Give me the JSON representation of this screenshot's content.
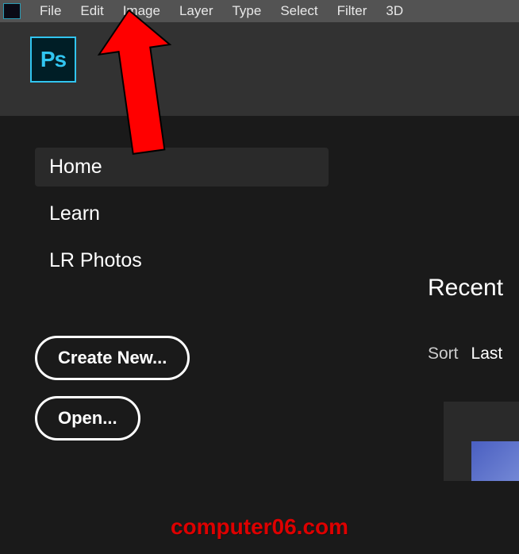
{
  "menubar": {
    "items": [
      "File",
      "Edit",
      "Image",
      "Layer",
      "Type",
      "Select",
      "Filter",
      "3D"
    ]
  },
  "logo": {
    "text": "Ps"
  },
  "sidebar": {
    "items": [
      {
        "label": "Home",
        "active": true
      },
      {
        "label": "Learn",
        "active": false
      },
      {
        "label": "LR Photos",
        "active": false
      }
    ]
  },
  "actions": {
    "create_new": "Create New...",
    "open": "Open..."
  },
  "recent": {
    "title": "Recent",
    "sort_label": "Sort",
    "sort_value": "Last"
  },
  "watermark": "computer06.com"
}
